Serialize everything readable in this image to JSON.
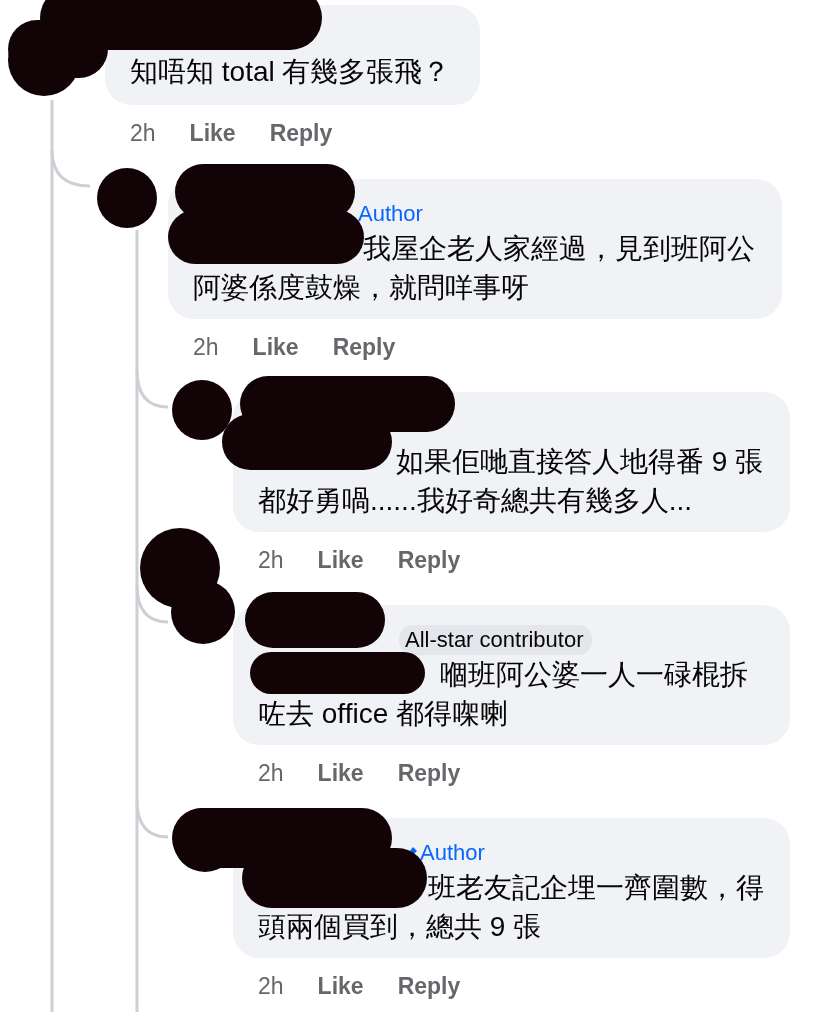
{
  "comment": {
    "body": "知唔知 total 有幾多張飛？",
    "time": "2h",
    "like": "Like",
    "reply": "Reply",
    "replies": [
      {
        "badge": {
          "kind": "author",
          "label": "Author",
          "icon": false
        },
        "body": "我屋企老人家經過，見到班阿公阿婆係度鼓燥，就問咩事呀",
        "time": "2h",
        "like": "Like",
        "reply": "Reply",
        "replies": [
          {
            "body": "如果佢哋直接答人地得番 9 張都好勇喎......我好奇總共有幾多人...",
            "time": "2h",
            "like": "Like",
            "reply": "Reply"
          },
          {
            "badge": {
              "kind": "contributor",
              "label": "All-star contributor"
            },
            "body": "嗰班阿公婆一人一碌棍拆咗去 office 都得㗎喇",
            "time": "2h",
            "like": "Like",
            "reply": "Reply"
          },
          {
            "badge": {
              "kind": "author",
              "label": "Author",
              "icon": true
            },
            "body": "班老友記企埋一齊圍數，得頭兩個買到，總共 9 張",
            "time": "2h",
            "like": "Like",
            "reply": "Reply"
          }
        ]
      }
    ]
  }
}
